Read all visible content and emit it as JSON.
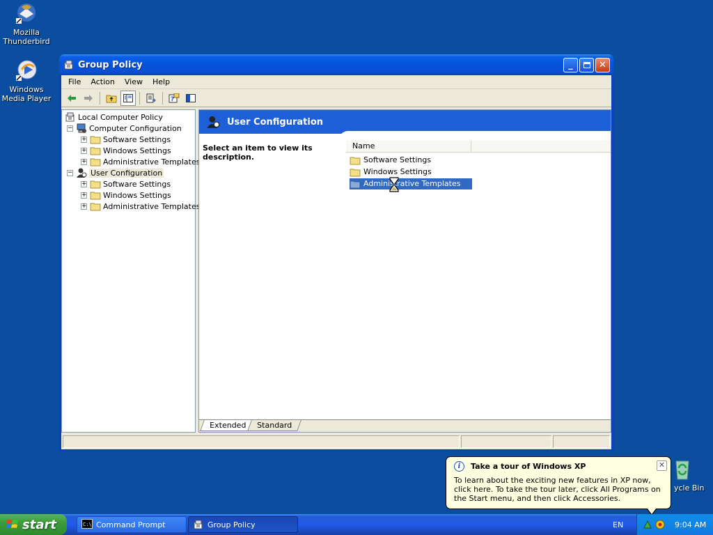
{
  "desktop": {
    "icons": [
      {
        "label": "Mozilla Thunderbird"
      },
      {
        "label": "Windows Media Player"
      },
      {
        "label": "ycle Bin"
      }
    ]
  },
  "window": {
    "title": "Group Policy",
    "menu": [
      "File",
      "Action",
      "View",
      "Help"
    ],
    "tree": [
      {
        "label": "Local Computer Policy",
        "level": 0
      },
      {
        "label": "Computer Configuration",
        "level": 1,
        "expanded": true
      },
      {
        "label": "Software Settings",
        "level": 2
      },
      {
        "label": "Windows Settings",
        "level": 2
      },
      {
        "label": "Administrative Templates",
        "level": 2
      },
      {
        "label": "User Configuration",
        "level": 1,
        "expanded": true,
        "selected": true
      },
      {
        "label": "Software Settings",
        "level": 2
      },
      {
        "label": "Windows Settings",
        "level": 2
      },
      {
        "label": "Administrative Templates",
        "level": 2
      }
    ],
    "pane": {
      "header": "User Configuration",
      "description": "Select an item to view its description.",
      "column": "Name",
      "items": [
        {
          "label": "Software Settings"
        },
        {
          "label": "Windows Settings"
        },
        {
          "label": "Administrative Templates",
          "selected": true
        }
      ],
      "tabs": [
        "Extended",
        "Standard"
      ]
    }
  },
  "balloon": {
    "title": "Take a tour of Windows XP",
    "text": "To learn about the exciting new features in XP now, click here. To take the tour later, click All Programs on the Start menu, and then click Accessories."
  },
  "taskbar": {
    "start": "start",
    "tasks": [
      "Command Prompt",
      "Group Policy"
    ],
    "language": "EN",
    "clock": "9:04 AM"
  },
  "colors": {
    "desktop": "#0b4d9e",
    "title_bar": "#0553dc",
    "selection": "#316ac5",
    "pane_header": "#1c5fd8"
  }
}
